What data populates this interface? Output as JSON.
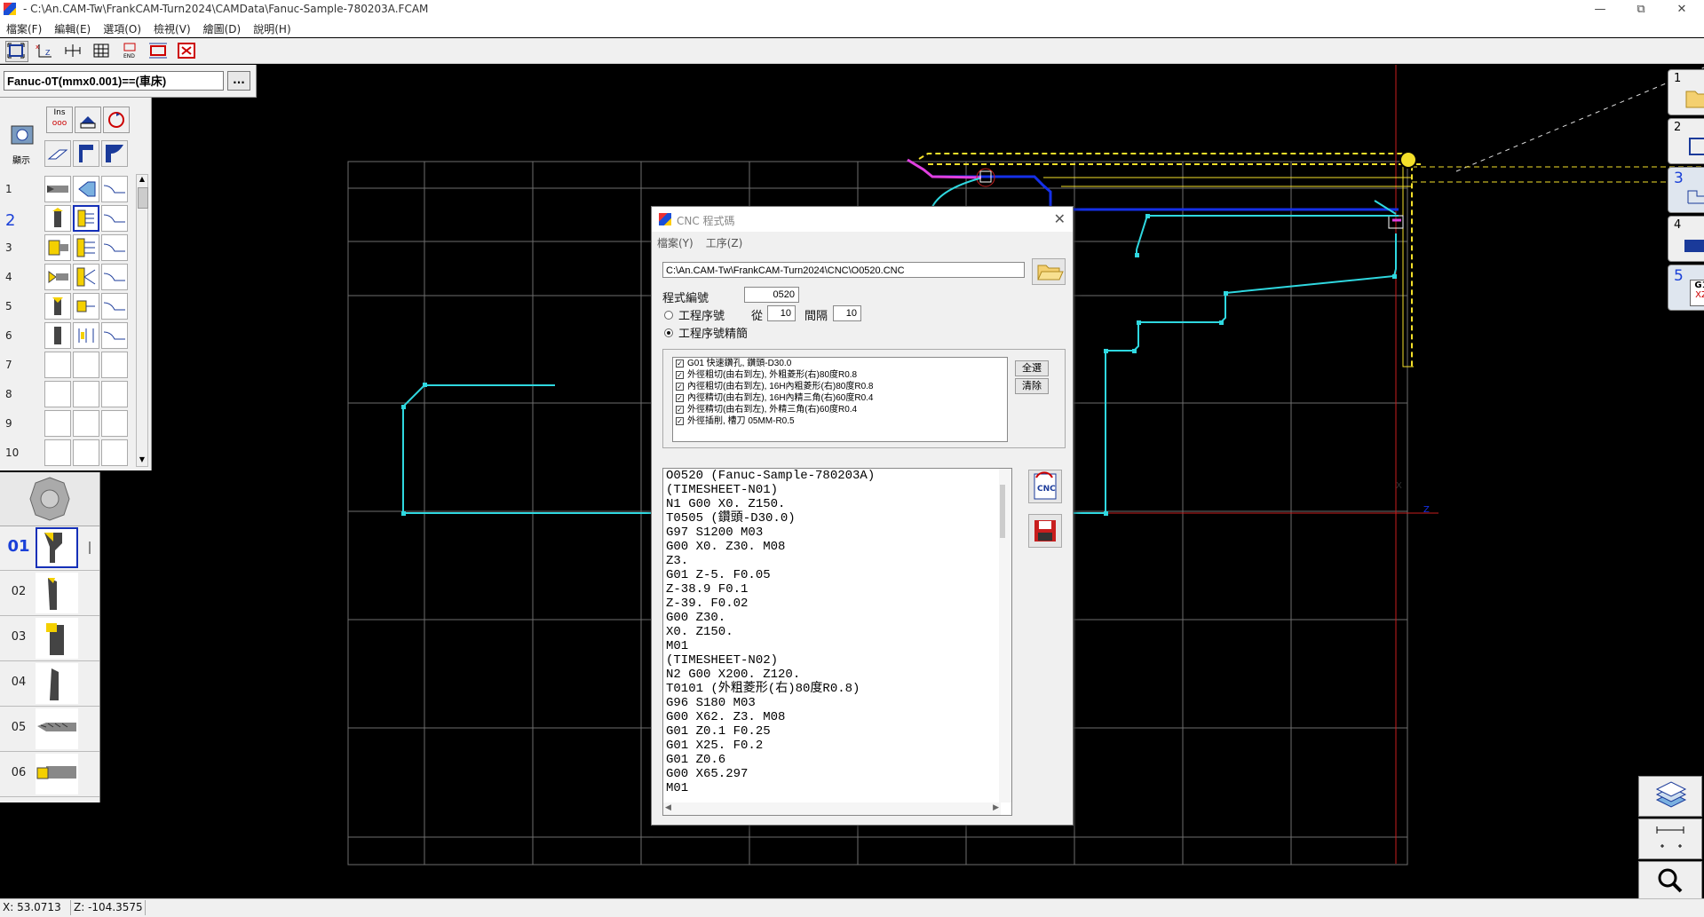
{
  "window": {
    "title": "- C:\\An.CAM-Tw\\FrankCAM-Turn2024\\CAMData\\Fanuc-Sample-780203A.FCAM",
    "minimize": "—",
    "maximize": "⧉",
    "close": "✕"
  },
  "menu": [
    "檔案(F)",
    "編輯(E)",
    "選項(O)",
    "檢視(V)",
    "繪圖(D)",
    "說明(H)"
  ],
  "toolbar": {
    "buttons": [
      "select-icon",
      "axis-icon",
      "dimension-icon",
      "grid-icon",
      "end-icon",
      "fit-icon",
      "zoom-all-icon"
    ]
  },
  "controller": {
    "value": "Fanuc-0T(mmx0.001)==(車床)",
    "browse": "..."
  },
  "left_panel": {
    "top_labels": [
      "Ins",
      "顯示"
    ],
    "rows": [
      "1",
      "2",
      "3",
      "4",
      "5",
      "6",
      "7",
      "8",
      "9",
      "10"
    ],
    "selected_row": "2"
  },
  "tool_list": {
    "items": [
      "01",
      "02",
      "03",
      "04",
      "05",
      "06"
    ],
    "selected": "01"
  },
  "right_panel": {
    "buttons": [
      "1",
      "2",
      "3",
      "4",
      "5"
    ],
    "g1_label": "G1",
    "xz_label": "XZ"
  },
  "status": {
    "x": "X: 53.0713",
    "z": "Z: -104.3575"
  },
  "dialog": {
    "title": "CNC 程式碼",
    "menu": [
      "檔案(Y)",
      "工序(Z)"
    ],
    "path": "C:\\An.CAM-Tw\\FrankCAM-Turn2024\\CNC\\O0520.CNC",
    "program_no_label": "程式編號",
    "program_no": "0520",
    "radio_seq": "工程序號",
    "from_label": "從",
    "from_value": "10",
    "interval_label": "間隔",
    "interval_value": "10",
    "radio_simplified": "工程序號精簡",
    "operations": [
      "G01 快速鑽孔, 鑽頭-D30.0",
      "外徑粗切(由右到左), 外粗菱形(右)80度R0.8",
      "內徑粗切(由右到左), 16H內粗菱形(右)80度R0.8",
      "內徑精切(由右到左), 16H內精三角(右)60度R0.4",
      "外徑精切(由右到左), 外精三角(右)60度R0.4",
      "外徑插削, 槽刀 05MM-R0.5"
    ],
    "select_all": "全選",
    "clear": "清除",
    "cnc_btn": "CNC",
    "code": [
      "O0520 (Fanuc-Sample-780203A)",
      "(TIMESHEET-N01)",
      "N1 G00 X0. Z150.",
      "T0505 (鑽頭-D30.0)",
      "G97 S1200 M03",
      "G00 X0. Z30. M08",
      "Z3.",
      "G01 Z-5. F0.05",
      "Z-38.9 F0.1",
      "Z-39. F0.02",
      "G00 Z30.",
      "X0. Z150.",
      "M01",
      "(TIMESHEET-N02)",
      "N2 G00 X200. Z120.",
      "T0101 (外粗菱形(右)80度R0.8)",
      "G96 S180 M03",
      "G00 X62. Z3. M08",
      "G01 Z0.1 F0.25",
      "G01 X25. F0.2",
      "G01 Z0.6",
      "G00 X65.297",
      "M01"
    ]
  },
  "colors": {
    "background": "#000000",
    "grid": "#6e6e6e",
    "toolpath": "#2fd8e0",
    "rapid": "#1530e8",
    "stock": "#f4e02a",
    "axis": "#c81e1e",
    "magenta": "#e040e0"
  }
}
